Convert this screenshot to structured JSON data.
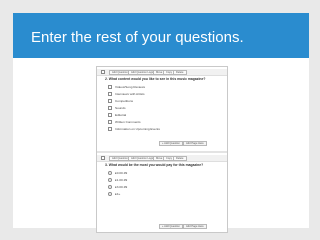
{
  "slide": {
    "title": "Enter the rest of your questions."
  },
  "colors": {
    "title_band": "#2a8ccf",
    "background": "#e9e9e9"
  },
  "question1": {
    "toolbar": [
      "Add Question",
      "Add Question Logic",
      "Move",
      "Copy",
      "Delete"
    ],
    "text": "2. What content would you like to see in this music magazine?",
    "options": [
      "Videos/Song Reviews",
      "Interviews with Artists",
      "Competitions",
      "Sounds",
      "Editorial",
      "Written Comments",
      "Information on Upcoming Events"
    ],
    "footer_buttons": [
      "+ Add Question",
      "Add Page Here"
    ]
  },
  "question2": {
    "toolbar": [
      "Add Question",
      "Add Question Logic",
      "Move",
      "Copy",
      "Delete"
    ],
    "text": "3. What would be the most you would pay for this magazine?",
    "options": [
      "£0.00-99",
      "£1.00-99",
      "£3.00-99",
      "£4+"
    ],
    "footer_buttons": [
      "+ Add Question",
      "Add Page Here"
    ]
  }
}
